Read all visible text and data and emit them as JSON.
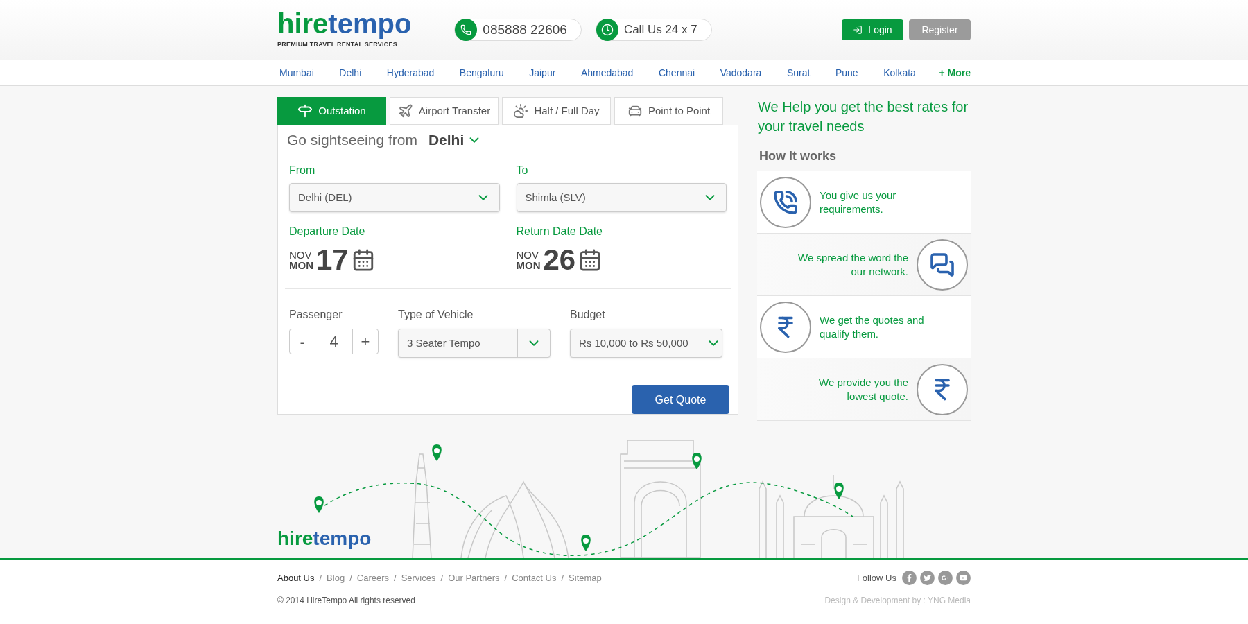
{
  "header": {
    "logo": {
      "first": "hire",
      "second": "tempo",
      "tagline": "PREMIUM TRAVEL RENTAL SERVICES"
    },
    "phone": "085888 22606",
    "support": "Call Us 24 x 7",
    "login": "Login",
    "register": "Register"
  },
  "nav": {
    "cities": [
      "Mumbai",
      "Delhi",
      "Hyderabad",
      "Bengaluru",
      "Jaipur",
      "Ahmedabad",
      "Chennai",
      "Vadodara",
      "Surat",
      "Pune",
      "Kolkata"
    ],
    "more": "+ More"
  },
  "tabs": [
    {
      "label": "Outstation",
      "selected": true
    },
    {
      "label": "Airport Transfer",
      "selected": false
    },
    {
      "label": "Half / Full Day",
      "selected": false
    },
    {
      "label": "Point to Point",
      "selected": false
    }
  ],
  "form": {
    "title": "Go sightseeing from",
    "city": "Delhi",
    "from": {
      "label": "From",
      "value": "Delhi (DEL)"
    },
    "to": {
      "label": "To",
      "value": "Shimla (SLV)"
    },
    "departure": {
      "label": "Departure Date",
      "month": "NOV",
      "weekday": "MON",
      "day": "17"
    },
    "return": {
      "label": "Return Date Date",
      "month": "NOV",
      "weekday": "MON",
      "day": "26"
    },
    "passenger": {
      "label": "Passenger",
      "minus": "-",
      "value": "4",
      "plus": "+"
    },
    "vehicle": {
      "label": "Type of Vehicle",
      "value": "3 Seater Tempo"
    },
    "budget": {
      "label": "Budget",
      "value": "Rs 10,000 to Rs 50,000"
    },
    "submit": "Get Quote"
  },
  "aside": {
    "heading": "We Help you get the best rates for your travel needs",
    "subheading": "How it works",
    "steps": [
      {
        "kind": "left",
        "text": "You give us your requirements."
      },
      {
        "kind": "right",
        "text": "We spread the word the our network."
      },
      {
        "kind": "left",
        "text": "We get the quotes and qualify them."
      },
      {
        "kind": "right",
        "text": "We provide you the lowest quote."
      }
    ]
  },
  "footer": {
    "logo": {
      "first": "hire",
      "second": "tempo"
    },
    "links": [
      {
        "label": "About Us",
        "selected": true
      },
      {
        "label": "Blog",
        "selected": false
      },
      {
        "label": "Careers",
        "selected": false
      },
      {
        "label": "Services",
        "selected": false
      },
      {
        "label": "Our Partners",
        "selected": false
      },
      {
        "label": "Contact Us",
        "selected": false
      },
      {
        "label": "Sitemap",
        "selected": false
      }
    ],
    "separator": "/",
    "copyright": "© 2014 HireTempo All rights reserved",
    "follow": "Follow Us",
    "credit": "Design & Development by : YNG Media"
  }
}
